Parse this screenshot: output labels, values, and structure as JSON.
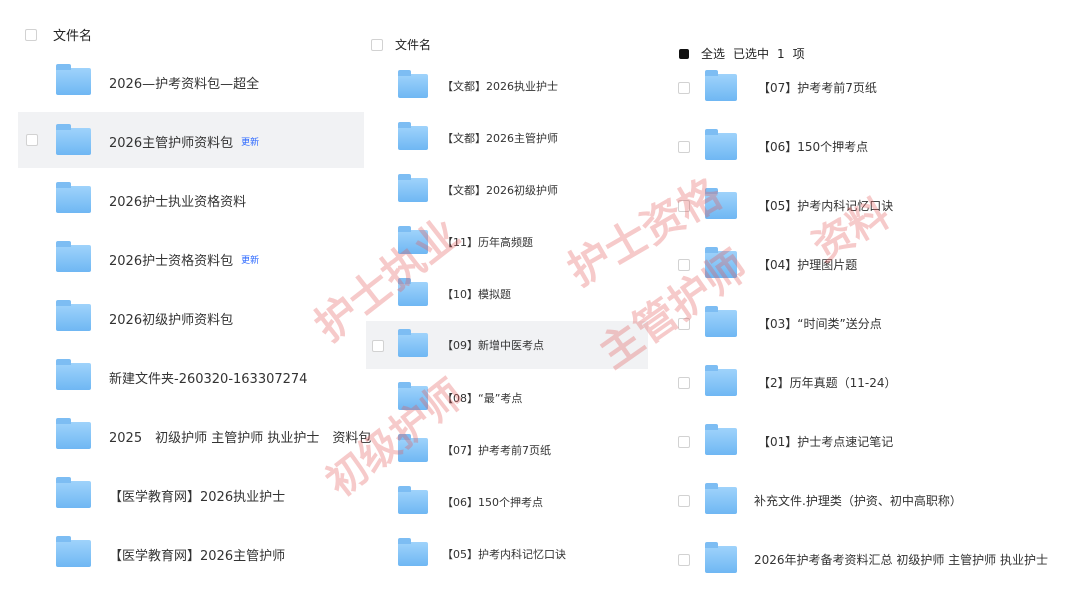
{
  "panel1": {
    "header_label": "文件名",
    "badge_label": "更新",
    "items": [
      {
        "name": "2026—护考资料包—超全",
        "badge": false
      },
      {
        "name": "2026主管护师资料包",
        "badge": true
      },
      {
        "name": "2026护士执业资格资料",
        "badge": false
      },
      {
        "name": "2026护士资格资料包",
        "badge": true
      },
      {
        "name": "2026初级护师资料包",
        "badge": false
      },
      {
        "name": "新建文件夹-260320-163307274",
        "badge": false
      },
      {
        "name": "2025　初级护师 主管护师 执业护士　资料包",
        "badge": false
      },
      {
        "name": "【医学教育网】2026执业护士",
        "badge": false
      },
      {
        "name": "【医学教育网】2026主管护师",
        "badge": false
      }
    ]
  },
  "panel2": {
    "header_label": "文件名",
    "items": [
      {
        "name": "【文都】2026执业护士"
      },
      {
        "name": "【文都】2026主管护师"
      },
      {
        "name": "【文都】2026初级护师"
      },
      {
        "name": "【11】历年高频题"
      },
      {
        "name": "【10】模拟题"
      },
      {
        "name": "【09】新增中医考点"
      },
      {
        "name": "【08】“最”考点"
      },
      {
        "name": "【07】护考考前7页纸"
      },
      {
        "name": "【06】150个押考点"
      },
      {
        "name": "【05】护考内科记忆口诀"
      }
    ]
  },
  "panel3": {
    "select_all_label": "全选",
    "selected_label": "已选中",
    "selected_count": "1",
    "selected_unit": "项",
    "items": [
      {
        "name": "【07】护考考前7页纸"
      },
      {
        "name": "【06】150个押考点"
      },
      {
        "name": "【05】护考内科记忆口诀"
      },
      {
        "name": "【04】护理图片题"
      },
      {
        "name": "【03】“时间类”送分点"
      },
      {
        "name": "【2】历年真题（11-24）"
      },
      {
        "name": "【01】护士考点速记笔记"
      },
      {
        "name": "补充文件.护理类（护资、初中高职称）"
      },
      {
        "name": "2026年护考备考资料汇总  初级护师 主管护师 执业护士"
      }
    ]
  },
  "watermarks": [
    {
      "text": "护士执业"
    },
    {
      "text": "护士资格"
    },
    {
      "text": "初级护师"
    },
    {
      "text": "主管护师"
    },
    {
      "text": "资料"
    }
  ],
  "colors": {
    "selected_row_bg": "#f1f2f4",
    "badge": "#2f6bff",
    "folder": "#6fb7f3",
    "watermark": "#e25a5a"
  }
}
